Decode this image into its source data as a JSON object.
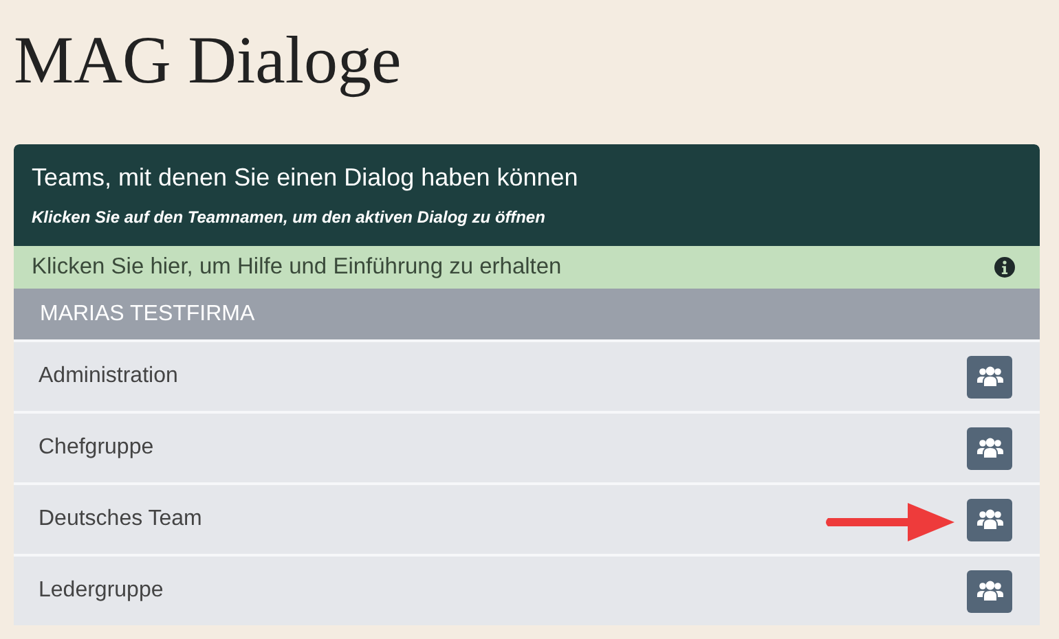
{
  "page_title": "MAG Dialoge",
  "panel": {
    "title": "Teams, mit denen Sie einen Dialog haben können",
    "subtitle": "Klicken Sie auf den Teamnamen, um den aktiven Dialog zu öffnen"
  },
  "help_bar": {
    "text": "Klicken Sie hier, um Hilfe und Einführung zu erhalten"
  },
  "company": {
    "name": "MARIAS TESTFIRMA"
  },
  "teams": [
    {
      "name": "Administration",
      "marked": false
    },
    {
      "name": "Chefgruppe",
      "marked": false
    },
    {
      "name": "Deutsches Team",
      "marked": true
    },
    {
      "name": "Ledergruppe",
      "marked": false
    }
  ]
}
